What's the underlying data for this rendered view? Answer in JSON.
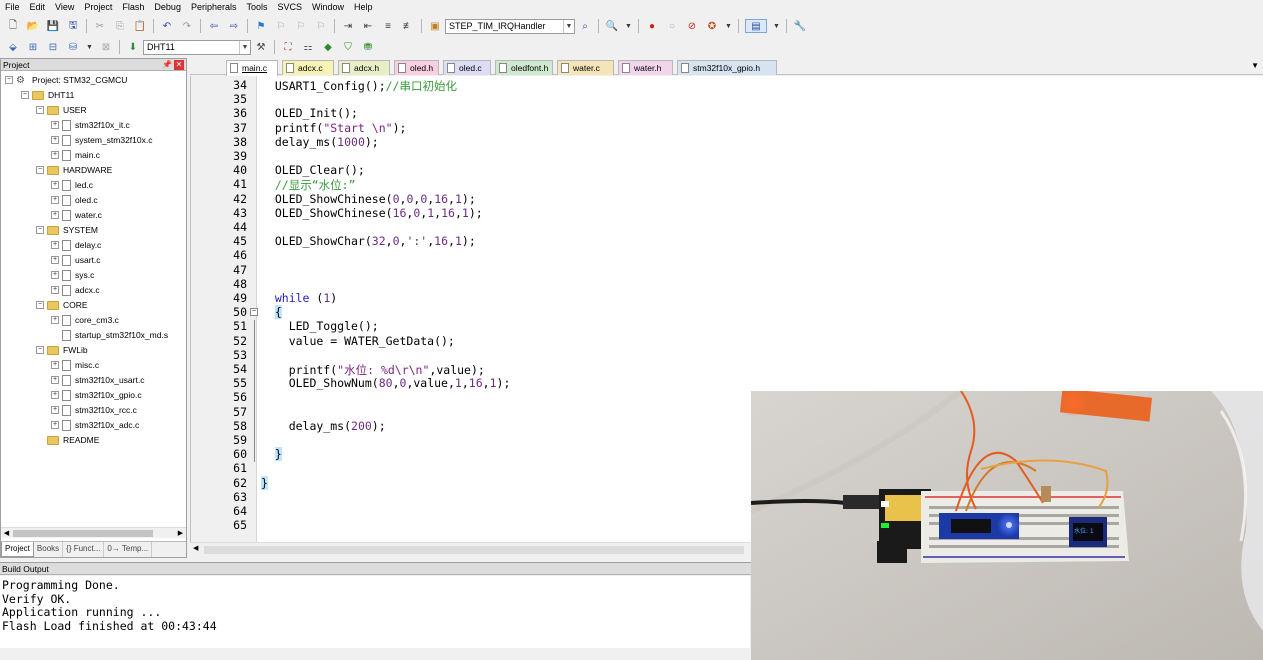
{
  "menu": [
    "File",
    "Edit",
    "View",
    "Project",
    "Flash",
    "Debug",
    "Peripherals",
    "Tools",
    "SVCS",
    "Window",
    "Help"
  ],
  "toolbar": {
    "function_combo": "STEP_TIM_IRQHandler",
    "target_combo": "DHT11"
  },
  "project_panel": {
    "title": "Project",
    "pin_icon": "pin-icon",
    "tree": [
      {
        "label": "Project: STM32_CGMCU",
        "type": "project",
        "level": 0
      },
      {
        "label": "DHT11",
        "type": "folder",
        "level": 1
      },
      {
        "label": "USER",
        "type": "folder",
        "level": 2
      },
      {
        "label": "stm32f10x_it.c",
        "type": "file",
        "level": 3
      },
      {
        "label": "system_stm32f10x.c",
        "type": "file",
        "level": 3
      },
      {
        "label": "main.c",
        "type": "file",
        "level": 3
      },
      {
        "label": "HARDWARE",
        "type": "folder",
        "level": 2
      },
      {
        "label": "led.c",
        "type": "file",
        "level": 3
      },
      {
        "label": "oled.c",
        "type": "file",
        "level": 3
      },
      {
        "label": "water.c",
        "type": "file",
        "level": 3
      },
      {
        "label": "SYSTEM",
        "type": "folder",
        "level": 2
      },
      {
        "label": "delay.c",
        "type": "file",
        "level": 3
      },
      {
        "label": "usart.c",
        "type": "file",
        "level": 3
      },
      {
        "label": "sys.c",
        "type": "file",
        "level": 3
      },
      {
        "label": "adcx.c",
        "type": "file",
        "level": 3
      },
      {
        "label": "CORE",
        "type": "folder",
        "level": 2
      },
      {
        "label": "core_cm3.c",
        "type": "file",
        "level": 3
      },
      {
        "label": "startup_stm32f10x_md.s",
        "type": "file-noexp",
        "level": 3
      },
      {
        "label": "FWLib",
        "type": "folder",
        "level": 2
      },
      {
        "label": "misc.c",
        "type": "file",
        "level": 3
      },
      {
        "label": "stm32f10x_usart.c",
        "type": "file",
        "level": 3
      },
      {
        "label": "stm32f10x_gpio.c",
        "type": "file",
        "level": 3
      },
      {
        "label": "stm32f10x_rcc.c",
        "type": "file",
        "level": 3
      },
      {
        "label": "stm32f10x_adc.c",
        "type": "file",
        "level": 3
      },
      {
        "label": "README",
        "type": "folder-noexp",
        "level": 2
      }
    ],
    "tabs": [
      "Project",
      "Books",
      "{} Funct...",
      "0→ Temp..."
    ]
  },
  "editor": {
    "tabs": [
      {
        "label": "main.c",
        "color": "#ffffff",
        "active": true
      },
      {
        "label": "adcx.c",
        "color": "#f7f3b5"
      },
      {
        "label": "adcx.h",
        "color": "#e6efc6"
      },
      {
        "label": "oled.h",
        "color": "#f7cfe0"
      },
      {
        "label": "oled.c",
        "color": "#dcdcf7"
      },
      {
        "label": "oledfont.h",
        "color": "#cfe9cf"
      },
      {
        "label": "water.c",
        "color": "#f5e4b8"
      },
      {
        "label": "water.h",
        "color": "#f1d5ea"
      },
      {
        "label": "stm32f10x_gpio.h",
        "color": "#d6e4f2"
      }
    ],
    "lines": [
      {
        "n": "34",
        "code": "  USART1_Config();//串口初始化"
      },
      {
        "n": "35",
        "code": ""
      },
      {
        "n": "36",
        "code": "  OLED_Init();"
      },
      {
        "n": "37",
        "code": "  printf(\"Start \\n\");"
      },
      {
        "n": "38",
        "code": "  delay_ms(1000);"
      },
      {
        "n": "39",
        "code": ""
      },
      {
        "n": "40",
        "code": "  OLED_Clear();"
      },
      {
        "n": "41",
        "code": "  //显示“水位:”"
      },
      {
        "n": "42",
        "code": "  OLED_ShowChinese(0,0,0,16,1);"
      },
      {
        "n": "43",
        "code": "  OLED_ShowChinese(16,0,1,16,1);"
      },
      {
        "n": "44",
        "code": ""
      },
      {
        "n": "45",
        "code": "  OLED_ShowChar(32,0,':',16,1);"
      },
      {
        "n": "46",
        "code": ""
      },
      {
        "n": "47",
        "code": ""
      },
      {
        "n": "48",
        "code": ""
      },
      {
        "n": "49",
        "code": "  while (1)"
      },
      {
        "n": "50",
        "code": "  {"
      },
      {
        "n": "51",
        "code": "    LED_Toggle();"
      },
      {
        "n": "52",
        "code": "    value = WATER_GetData();"
      },
      {
        "n": "53",
        "code": ""
      },
      {
        "n": "54",
        "code": "    printf(\"水位: %d\\r\\n\",value);"
      },
      {
        "n": "55",
        "code": "    OLED_ShowNum(80,0,value,1,16,1);"
      },
      {
        "n": "56",
        "code": ""
      },
      {
        "n": "57",
        "code": ""
      },
      {
        "n": "58",
        "code": "    delay_ms(200);"
      },
      {
        "n": "59",
        "code": ""
      },
      {
        "n": "60",
        "code": "  }"
      },
      {
        "n": "61",
        "code": ""
      },
      {
        "n": "62",
        "code": "}"
      },
      {
        "n": "63",
        "code": ""
      },
      {
        "n": "64",
        "code": ""
      },
      {
        "n": "65",
        "code": ""
      }
    ]
  },
  "build_output": {
    "title": "Build Output",
    "lines": [
      "Programming Done.",
      "Verify OK.",
      "Application running ...",
      "Flash Load finished at 00:43:44"
    ]
  }
}
